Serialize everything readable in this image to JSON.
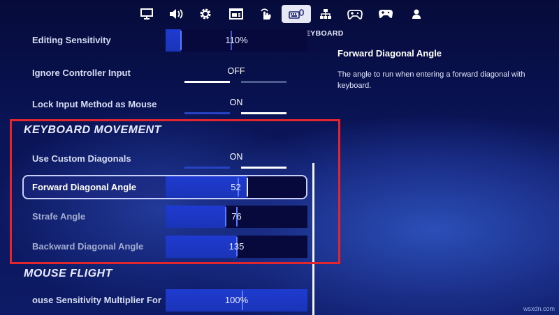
{
  "tabs": [
    {
      "icon": "monitor-icon",
      "active": false
    },
    {
      "icon": "speaker-icon",
      "active": false
    },
    {
      "icon": "gear-icon",
      "active": false
    },
    {
      "icon": "display-window-icon",
      "active": false
    },
    {
      "icon": "touch-hand-icon",
      "active": false
    },
    {
      "icon": "keyboard-mouse-icon",
      "active": true
    },
    {
      "icon": "network-icon",
      "active": false
    },
    {
      "icon": "controller-settings-icon",
      "active": false
    },
    {
      "icon": "gamepad-icon",
      "active": false
    },
    {
      "icon": "account-icon",
      "active": false
    }
  ],
  "active_tab_label": "EYBOARD",
  "rows": {
    "editing_sensitivity": {
      "label": "Editing Sensitivity",
      "value": "110%",
      "fraction": 0.11
    },
    "ignore_controller_input": {
      "label": "Ignore Controller Input",
      "value": "OFF"
    },
    "lock_input_method": {
      "label": "Lock Input Method as Mouse",
      "value": "ON"
    },
    "use_custom_diagonals": {
      "label": "Use Custom Diagonals",
      "value": "ON"
    },
    "forward_diagonal_angle": {
      "label": "Forward Diagonal Angle",
      "value": "52",
      "fraction": 0.58
    },
    "strafe_angle": {
      "label": "Strafe Angle",
      "value": "76",
      "fraction": 0.42
    },
    "backward_diagonal_angle": {
      "label": "Backward Diagonal Angle",
      "value": "135",
      "fraction": 0.5
    },
    "mouse_sensitivity_multiplier": {
      "label": "ouse Sensitivity Multiplier For",
      "value": "100%",
      "fraction": 0.54
    }
  },
  "sections": {
    "keyboard_movement": "KEYBOARD MOVEMENT",
    "mouse_flight": "MOUSE FLIGHT"
  },
  "description": {
    "title": "Forward Diagonal Angle",
    "text": "The angle to run when entering a forward diagonal with keyboard."
  },
  "watermark": "wsxdn.com",
  "colors": {
    "highlight_box": "#e1262e",
    "slider_fill": "#1f3bd0",
    "toggle_on": "#ffffff",
    "background": "#0a1456"
  }
}
